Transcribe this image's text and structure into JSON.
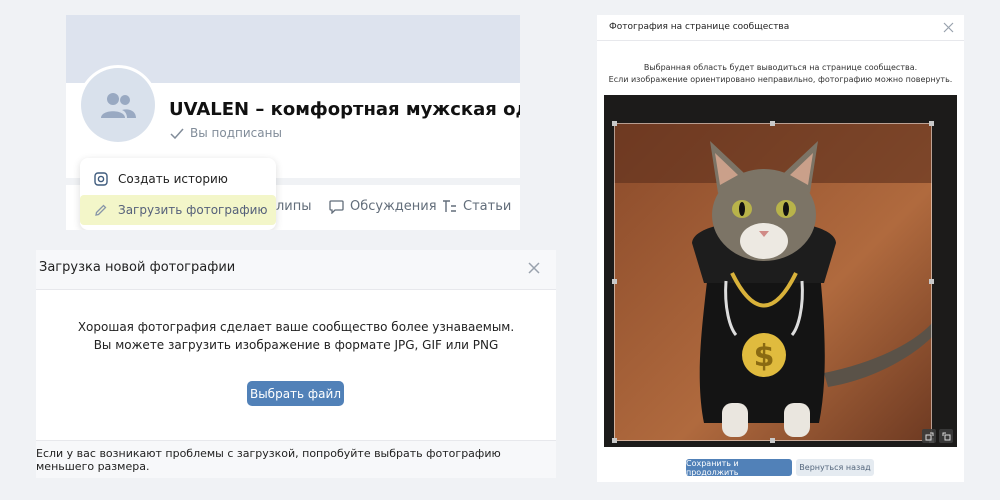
{
  "community": {
    "title": "UVALEN – комфортная мужская одежда",
    "subscribed_label": "Вы подписаны",
    "tabs": [
      "липы",
      "Обсуждения",
      "Статьи"
    ],
    "menu": {
      "items": [
        {
          "label": "Создать историю",
          "icon": "instagram-icon"
        },
        {
          "label": "Загрузить фотографию",
          "icon": "pencil-icon",
          "highlighted": true
        }
      ]
    }
  },
  "upload_dialog": {
    "title": "Загрузка новой фотографии",
    "message_line1": "Хорошая фотография сделает ваше сообщество более узнаваемым.",
    "message_line2": "Вы можете загрузить изображение в формате JPG, GIF или PNG",
    "choose_button": "Выбрать файл",
    "footer": "Если у вас возникают проблемы с загрузкой, попробуйте выбрать фотографию меньшего размера."
  },
  "crop_dialog": {
    "title": "Фотография на странице сообщества",
    "message_line1": "Выбранная область будет выводиться на странице сообщества.",
    "message_line2": "Если изображение ориентировано неправильно, фотографию можно повернуть.",
    "save_button": "Сохранить и продолжить",
    "back_button": "Вернуться назад"
  },
  "colors": {
    "accent": "#5181b8",
    "highlight": "#f3f6c9",
    "cover": "#dde3ee"
  }
}
